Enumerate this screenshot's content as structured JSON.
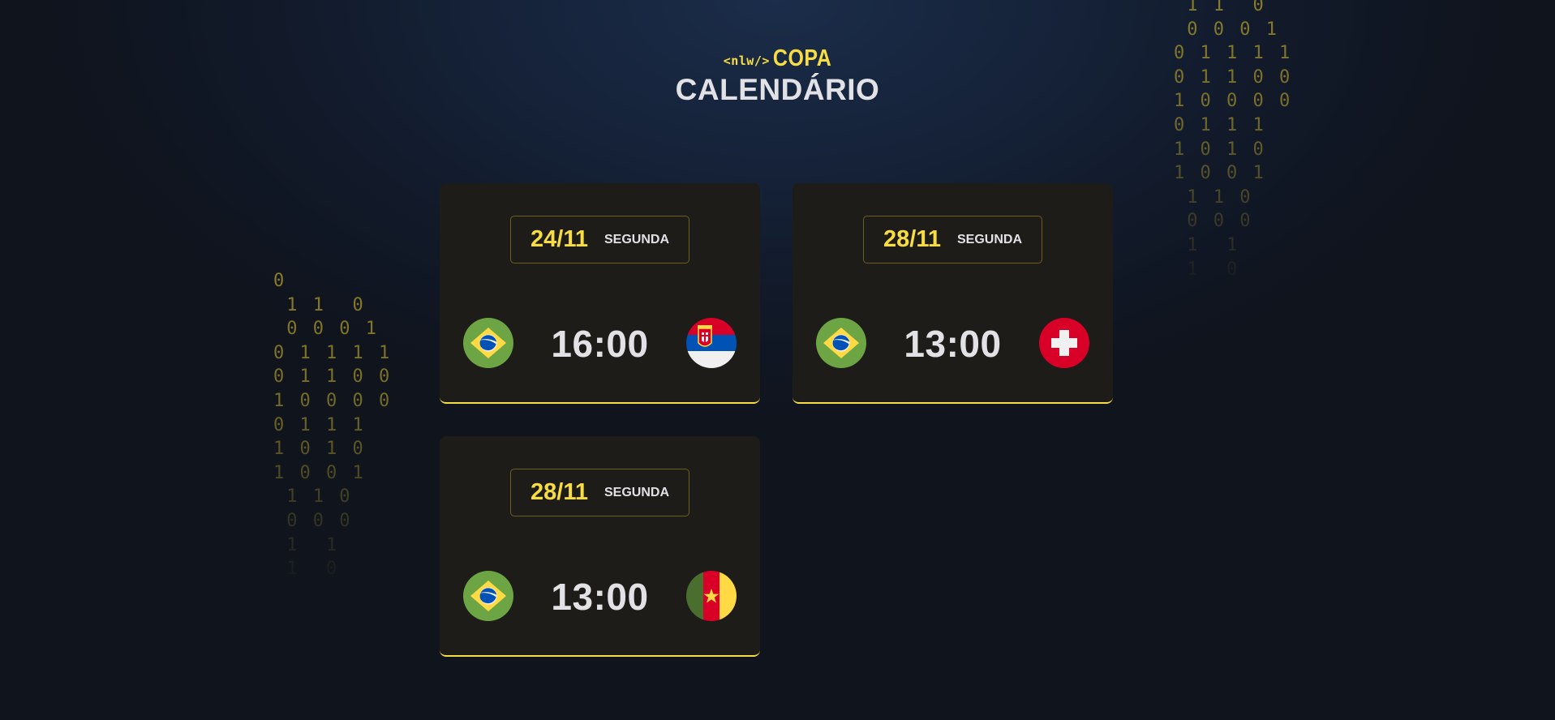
{
  "header": {
    "logo_tag": "<nlw/>",
    "logo_word": "COPA",
    "title": "CALENDÁRIO"
  },
  "binary_left": [
    "0",
    " 1 1  0",
    " 0 0 0 1",
    "0 1 1 1 1",
    "0 1 1 0 0",
    "1 0 0 0 0",
    "0 1 1 1",
    "1 0 1 0",
    "1 0 0 1",
    " 1 1 0",
    " 0 0 0",
    " 1  1",
    " 1  0"
  ],
  "binary_right": [
    " 1 1  0",
    " 0 0 0 1",
    "0 1 1 1 1",
    "0 1 1 0 0",
    "1 0 0 0 0",
    "0 1 1 1",
    "1 0 1 0",
    "1 0 0 1",
    " 1 1 0",
    " 0 0 0",
    " 1  1",
    " 1  0"
  ],
  "matches": [
    {
      "date": "24/11",
      "weekday": "SEGUNDA",
      "time": "16:00",
      "home_flag": "brazil-flag-icon",
      "away_flag": "serbia-flag-icon"
    },
    {
      "date": "28/11",
      "weekday": "SEGUNDA",
      "time": "13:00",
      "home_flag": "brazil-flag-icon",
      "away_flag": "switzerland-flag-icon"
    },
    {
      "date": "28/11",
      "weekday": "SEGUNDA",
      "time": "13:00",
      "home_flag": "brazil-flag-icon",
      "away_flag": "cameroon-flag-icon"
    }
  ],
  "colors": {
    "accent": "#f7dd43",
    "card_bg": "#1e1c18",
    "text": "#e1e1e6",
    "background": "#121a27"
  }
}
